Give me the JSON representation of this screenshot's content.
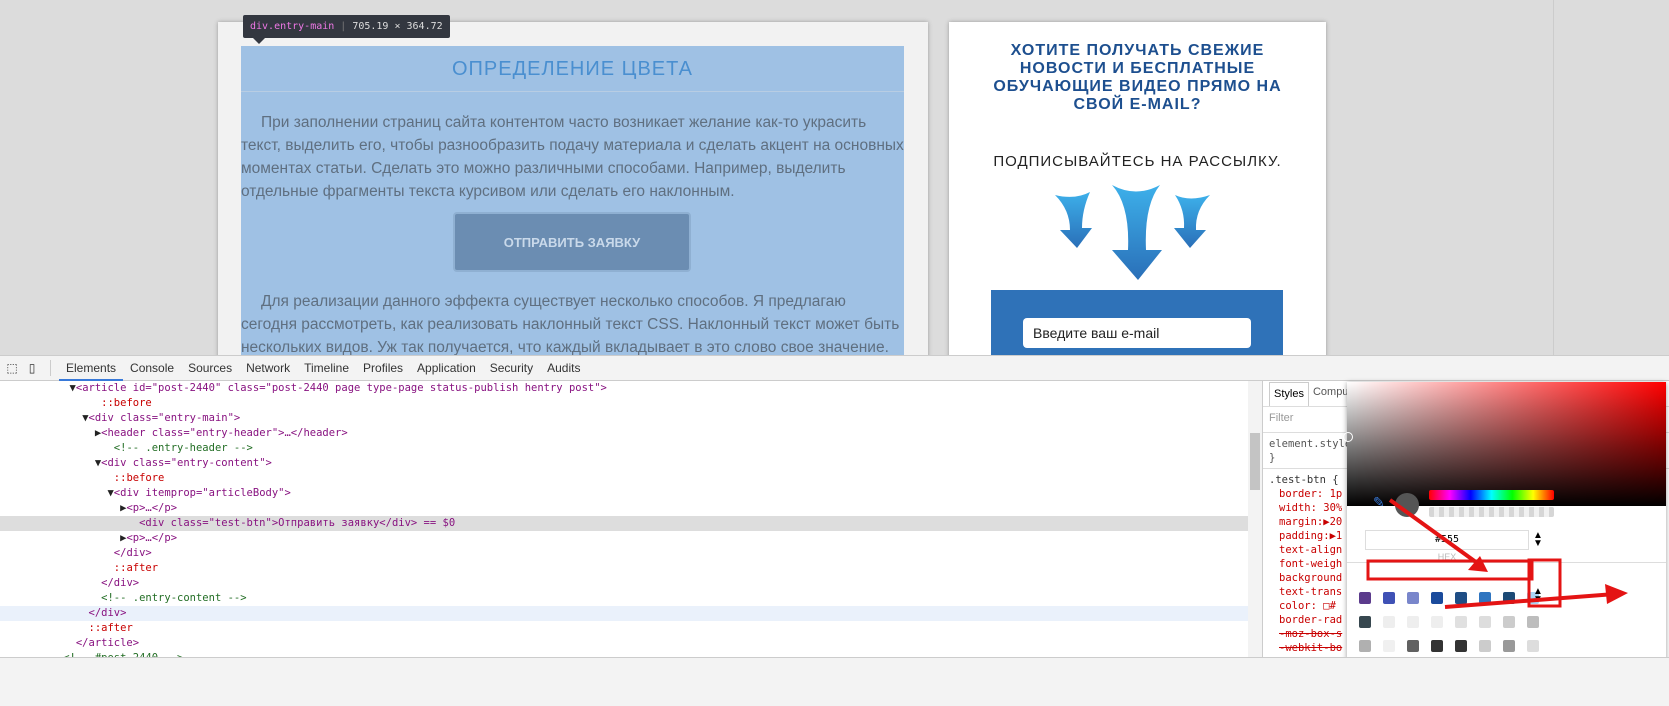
{
  "page": {
    "heading": "ОПРЕДЕЛЕНИЕ ЦВЕТА",
    "paragraph1": "При заполнении страниц сайта контентом часто возникает желание как-то украсить текст, выделить его, чтобы разнообразить подачу материала и сделать акцент на основных моментах статьи. Сделать это можно различными способами. Например, выделить отдельные фрагменты текста курсивом или сделать его наклонным.",
    "button": "ОТПРАВИТЬ ЗАЯВКУ",
    "paragraph2": "Для реализации данного эффекта существует несколько способов. Я предлагаю сегодня рассмотреть, как реализовать наклонный текст CSS. Наклонный текст может быть нескольких видов. Уж так получается, что каждый вкладывает в это слово свое значение. Мы сегодня",
    "tooltip_tag": "div.entry-main",
    "tooltip_size": "705.19 × 364.72"
  },
  "sidebar": {
    "promo": "ХОТИТЕ ПОЛУЧАТЬ СВЕЖИЕ НОВОСТИ И БЕСПЛАТНЫЕ ОБУЧАЮЩИЕ ВИДЕО ПРЯМО НА СВОЙ E-MAIL?",
    "subscribe": "ПОДПИСЫВАЙТЕСЬ НА РАССЫЛКУ.",
    "email_placeholder": "Введите ваш e-mail"
  },
  "devtools": {
    "tabs": [
      "Elements",
      "Console",
      "Sources",
      "Network",
      "Timeline",
      "Profiles",
      "Application",
      "Security",
      "Audits"
    ],
    "lines": [
      "<article id=\"post-2440\" class=\"post-2440 page type-page status-publish hentry post\">",
      "::before",
      "<div class=\"entry-main\">",
      "<header class=\"entry-header\">…</header>",
      "<!-- .entry-header -->",
      "<div class=\"entry-content\">",
      "::before",
      "<div itemprop=\"articleBody\">",
      "<p>…</p>",
      "<div class=\"test-btn\">Отправить заявку</div> == $0",
      "<p>…</p>",
      "</div>",
      "::after",
      "</div>",
      "<!-- .entry-content -->",
      "</div>",
      "::after",
      "</article>",
      "<!-- #post-2440 -->"
    ],
    "styles_tabs": [
      "Styles",
      "Compu"
    ],
    "filter": "Filter",
    "element_style": "element.style {",
    "close": "}",
    "selector": ".test-btn {",
    "props": [
      "border: 1p",
      "width: 30%",
      "margin:▶20",
      "padding:▶1",
      "text-align",
      "font-weigh",
      "background",
      "text-trans",
      "color: □#",
      "border-rad",
      "-moz-box-s",
      "-webkit-bo",
      "box-shadow"
    ],
    "picker": {
      "hex": "#555",
      "format": "HEX",
      "current_color": "#555555",
      "swatches": [
        "#5b3b8c",
        "#3f51b5",
        "#7986cb",
        "#1a4b9c",
        "#1f4e85",
        "#2f75c0",
        "#1c4a75",
        "#a8d4f5",
        "#37474f",
        "#eeeeee",
        "#eeeeee",
        "#eeeeee",
        "#e0e0e0",
        "#dddddd",
        "#cccccc",
        "#bdbdbd",
        "#b0b0b0",
        "#f0f0f0",
        "#616161",
        "#333333",
        "#333333",
        "#cccccc",
        "#999999",
        "#dddddd"
      ]
    }
  }
}
